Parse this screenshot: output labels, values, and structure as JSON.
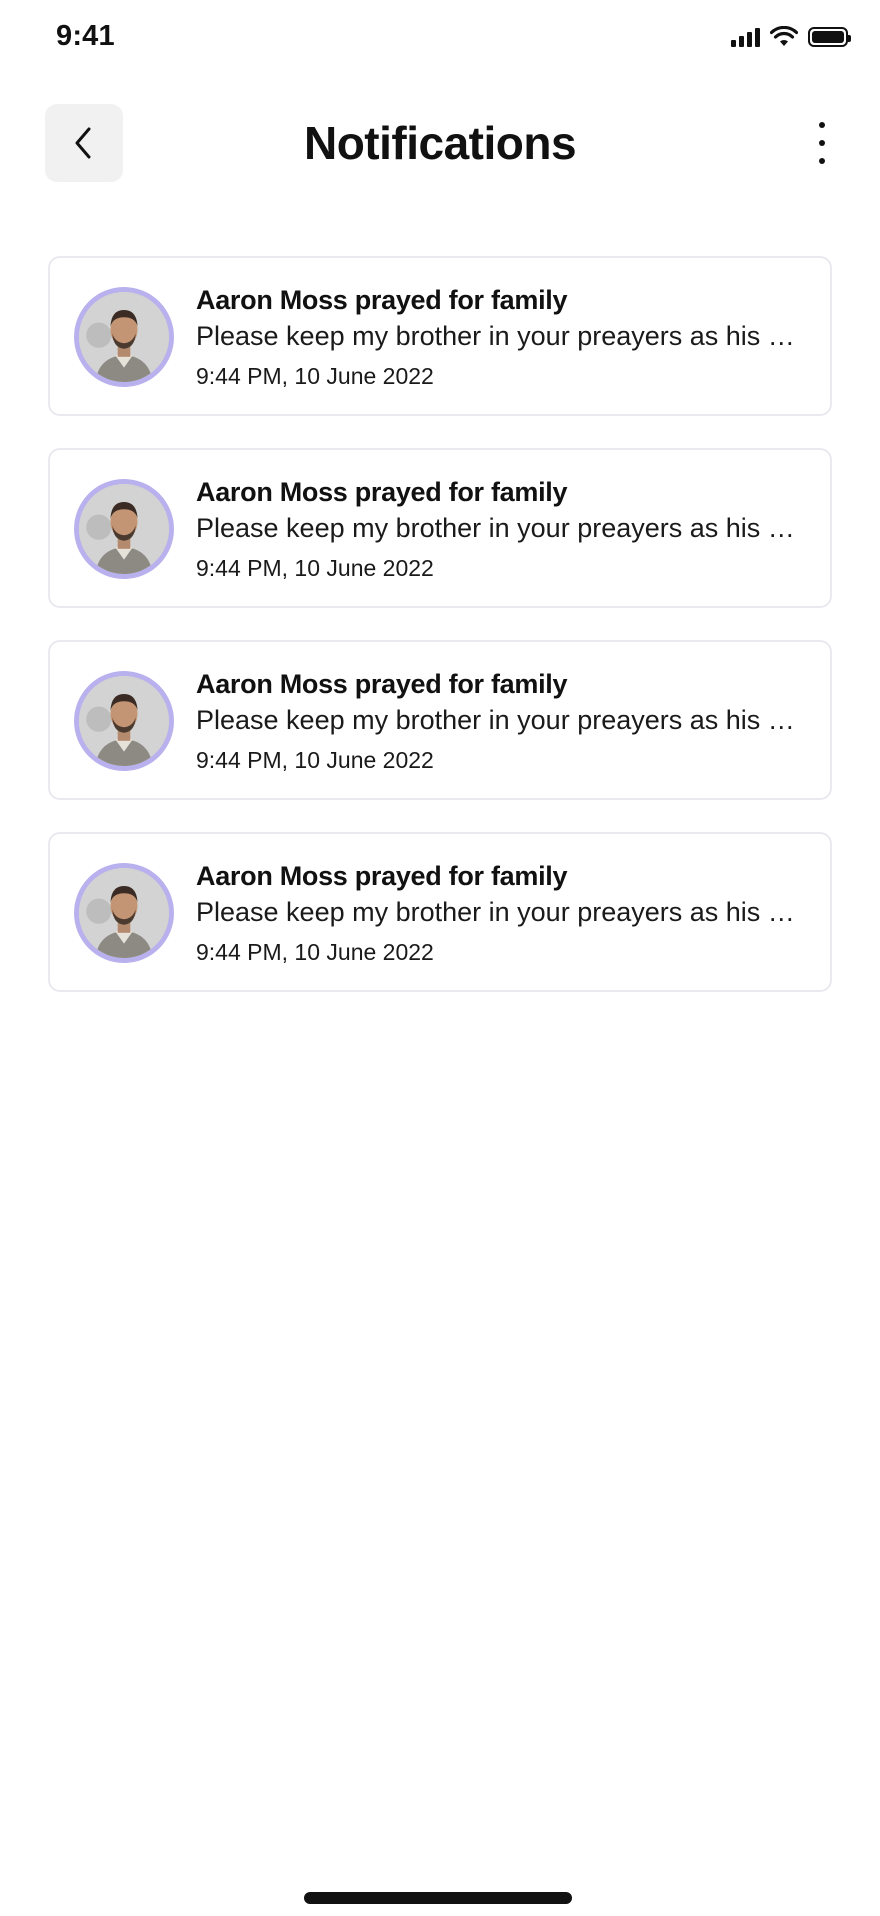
{
  "status_bar": {
    "time": "9:41",
    "icons": [
      "signal-icon",
      "wifi-icon",
      "battery-icon"
    ]
  },
  "header": {
    "title": "Notifications",
    "back_icon": "chevron-left-icon",
    "more_icon": "more-vertical-icon"
  },
  "colors": {
    "avatar_ring": "#b9b0ee",
    "card_border": "#e9e9ef",
    "back_button_bg": "#f1f1f1"
  },
  "notifications": [
    {
      "title": "Aaron Moss prayed for family",
      "body": "Please keep my brother in your preayers as his surgery is tomorrow",
      "time": "9:44 PM, 10 June 2022"
    },
    {
      "title": "Aaron Moss prayed for family",
      "body": "Please keep my brother in your preayers as his surgery is tomorrow",
      "time": "9:44 PM, 10 June 2022"
    },
    {
      "title": "Aaron Moss prayed for family",
      "body": "Please keep my brother in your preayers as his surgery is tomorrow",
      "time": "9:44 PM, 10 June 2022"
    },
    {
      "title": "Aaron Moss prayed for family",
      "body": "Please keep my brother in your preayers as his surgery is tomorrow",
      "time": "9:44 PM, 10 June 2022"
    }
  ]
}
